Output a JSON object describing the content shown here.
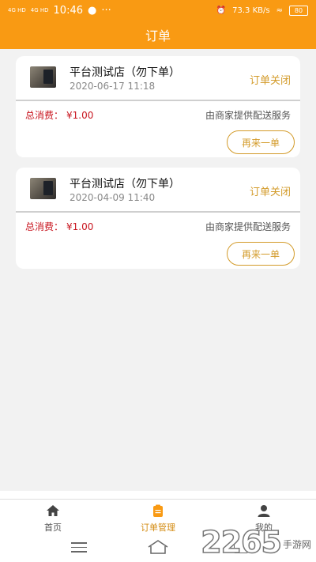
{
  "status_bar": {
    "signal1": "4G HD",
    "signal2": "4G HD",
    "time": "10:46",
    "dots": "···",
    "speed": "73.3 KB/s",
    "battery": "80"
  },
  "header": {
    "title": "订单"
  },
  "orders": [
    {
      "shop_name": "平台测试店（勿下单）",
      "date": "2020-06-17 11:18",
      "status": "订单关闭",
      "total_label": "总消费：",
      "total_amount": "¥1.00",
      "delivery": "由商家提供配送服务",
      "reorder": "再来一单"
    },
    {
      "shop_name": "平台测试店（勿下单）",
      "date": "2020-04-09 11:40",
      "status": "订单关闭",
      "total_label": "总消费：",
      "total_amount": "¥1.00",
      "delivery": "由商家提供配送服务",
      "reorder": "再来一单"
    }
  ],
  "tabbar": {
    "items": [
      {
        "label": "首页",
        "icon": "home-icon"
      },
      {
        "label": "订单管理",
        "icon": "clipboard-icon",
        "active": true
      },
      {
        "label": "我的",
        "icon": "user-icon"
      }
    ],
    "active_color": "#d38b11"
  },
  "watermark": {
    "number": "2265",
    "text": "手游网"
  },
  "colors": {
    "header": "#f99a13",
    "accent": "#d39b2a",
    "price": "#c8141e"
  }
}
